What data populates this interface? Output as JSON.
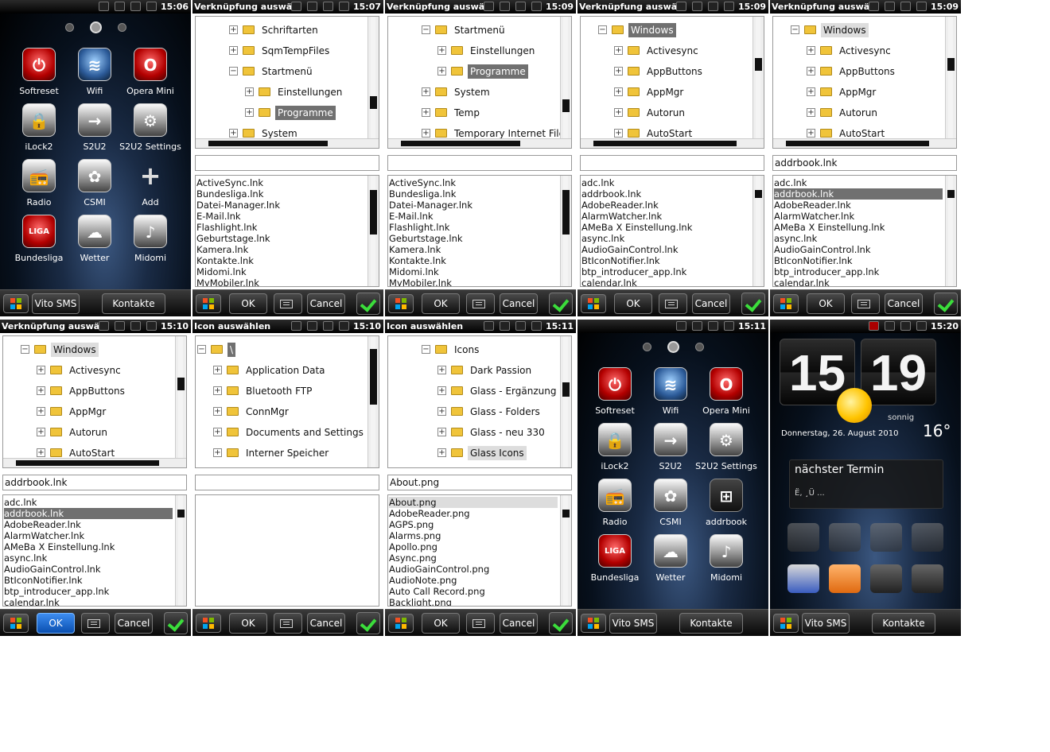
{
  "home": {
    "time": "15:06",
    "time2": "15:11",
    "apps": [
      "Softreset",
      "Wifi",
      "Opera Mini",
      "iLock2",
      "S2U2",
      "S2U2 Settings",
      "Radio",
      "CSMI",
      "Add",
      "Bundesliga",
      "Wetter",
      "Midomi"
    ],
    "apps2": [
      "Softreset",
      "Wifi",
      "Opera Mini",
      "iLock2",
      "S2U2",
      "S2U2 Settings",
      "Radio",
      "CSMI",
      "addrbook",
      "Bundesliga",
      "Wetter",
      "Midomi"
    ],
    "left_soft": "Vito SMS",
    "right_soft": "Kontakte"
  },
  "dialog": {
    "title_shortcut": "Verknüpfung auswäl",
    "title_icon": "Icon auswählen",
    "ok": "OK",
    "cancel": "Cancel"
  },
  "p2": {
    "time": "15:07",
    "tree": [
      "Schriftarten",
      "SqmTempFiles",
      "Startmenü",
      "Einstellungen",
      "Programme",
      "System"
    ],
    "edit": "",
    "list": [
      "ActiveSync.lnk",
      "Bundesliga.lnk",
      "Datei-Manager.lnk",
      "E-Mail.lnk",
      "Flashlight.lnk",
      "Geburtstage.lnk",
      "Kamera.lnk",
      "Kontakte.lnk",
      "Midomi.lnk",
      "MyMobiler.lnk"
    ]
  },
  "p3": {
    "time": "15:09",
    "tree": [
      "Startmenü",
      "Einstellungen",
      "Programme",
      "System",
      "Temp",
      "Temporary Internet Files"
    ],
    "edit": "",
    "list": [
      "ActiveSync.lnk",
      "Bundesliga.lnk",
      "Datei-Manager.lnk",
      "E-Mail.lnk",
      "Flashlight.lnk",
      "Geburtstage.lnk",
      "Kamera.lnk",
      "Kontakte.lnk",
      "Midomi.lnk",
      "MyMobiler.lnk"
    ]
  },
  "p4": {
    "time": "15:09",
    "tree": [
      "Windows",
      "Activesync",
      "AppButtons",
      "AppMgr",
      "Autorun",
      "AutoStart"
    ],
    "edit": "",
    "list": [
      "adc.lnk",
      "addrbook.lnk",
      "AdobeReader.lnk",
      "AlarmWatcher.lnk",
      "AMeBa X Einstellung.lnk",
      "async.lnk",
      "AudioGainControl.lnk",
      "BtIconNotifier.lnk",
      "btp_introducer_app.lnk",
      "calendar.lnk"
    ]
  },
  "p5": {
    "time": "15:09",
    "tree": [
      "Windows",
      "Activesync",
      "AppButtons",
      "AppMgr",
      "Autorun",
      "AutoStart"
    ],
    "edit": "addrbook.lnk",
    "list": [
      "adc.lnk",
      "addrbook.lnk",
      "AdobeReader.lnk",
      "AlarmWatcher.lnk",
      "AMeBa X Einstellung.lnk",
      "async.lnk",
      "AudioGainControl.lnk",
      "BtIconNotifier.lnk",
      "btp_introducer_app.lnk",
      "calendar.lnk"
    ]
  },
  "p6": {
    "time": "15:10",
    "tree": [
      "Windows",
      "Activesync",
      "AppButtons",
      "AppMgr",
      "Autorun",
      "AutoStart"
    ],
    "edit": "addrbook.lnk",
    "list": [
      "adc.lnk",
      "addrbook.lnk",
      "AdobeReader.lnk",
      "AlarmWatcher.lnk",
      "AMeBa X Einstellung.lnk",
      "async.lnk",
      "AudioGainControl.lnk",
      "BtIconNotifier.lnk",
      "btp_introducer_app.lnk",
      "calendar.lnk"
    ]
  },
  "p7": {
    "time": "15:10",
    "tree": [
      "\\",
      "Application Data",
      "Bluetooth FTP",
      "ConnMgr",
      "Documents and Settings",
      "Interner Speicher"
    ],
    "edit": "",
    "list": []
  },
  "p8": {
    "time": "15:11",
    "tree": [
      "Icons",
      "Dark Passion",
      "Glass - Ergänzung",
      "Glass - Folders",
      "Glass - neu 330",
      "Glass Icons"
    ],
    "edit": "About.png",
    "list": [
      "About.png",
      "AdobeReader.png",
      "AGPS.png",
      "Alarms.png",
      "Apollo.png",
      "Async.png",
      "AudioGainControl.png",
      "AudioNote.png",
      "Auto Call Record.png",
      "Backlight.png"
    ]
  },
  "clock": {
    "time": "15:20",
    "hour": "15",
    "minute": "19",
    "weather": "sonnig",
    "date": "Donnerstag, 26. August 2010",
    "temp": "16°",
    "termin": "nächster Termin",
    "termin_detail": "Ë, ¸Ü ...",
    "left_soft": "Vito SMS",
    "right_soft": "Kontakte"
  },
  "colors": {
    "selection": "#707070",
    "ok_selected": "#1e6fd9",
    "check_green": "#3bdd3b",
    "folder": "#f0c43a"
  }
}
